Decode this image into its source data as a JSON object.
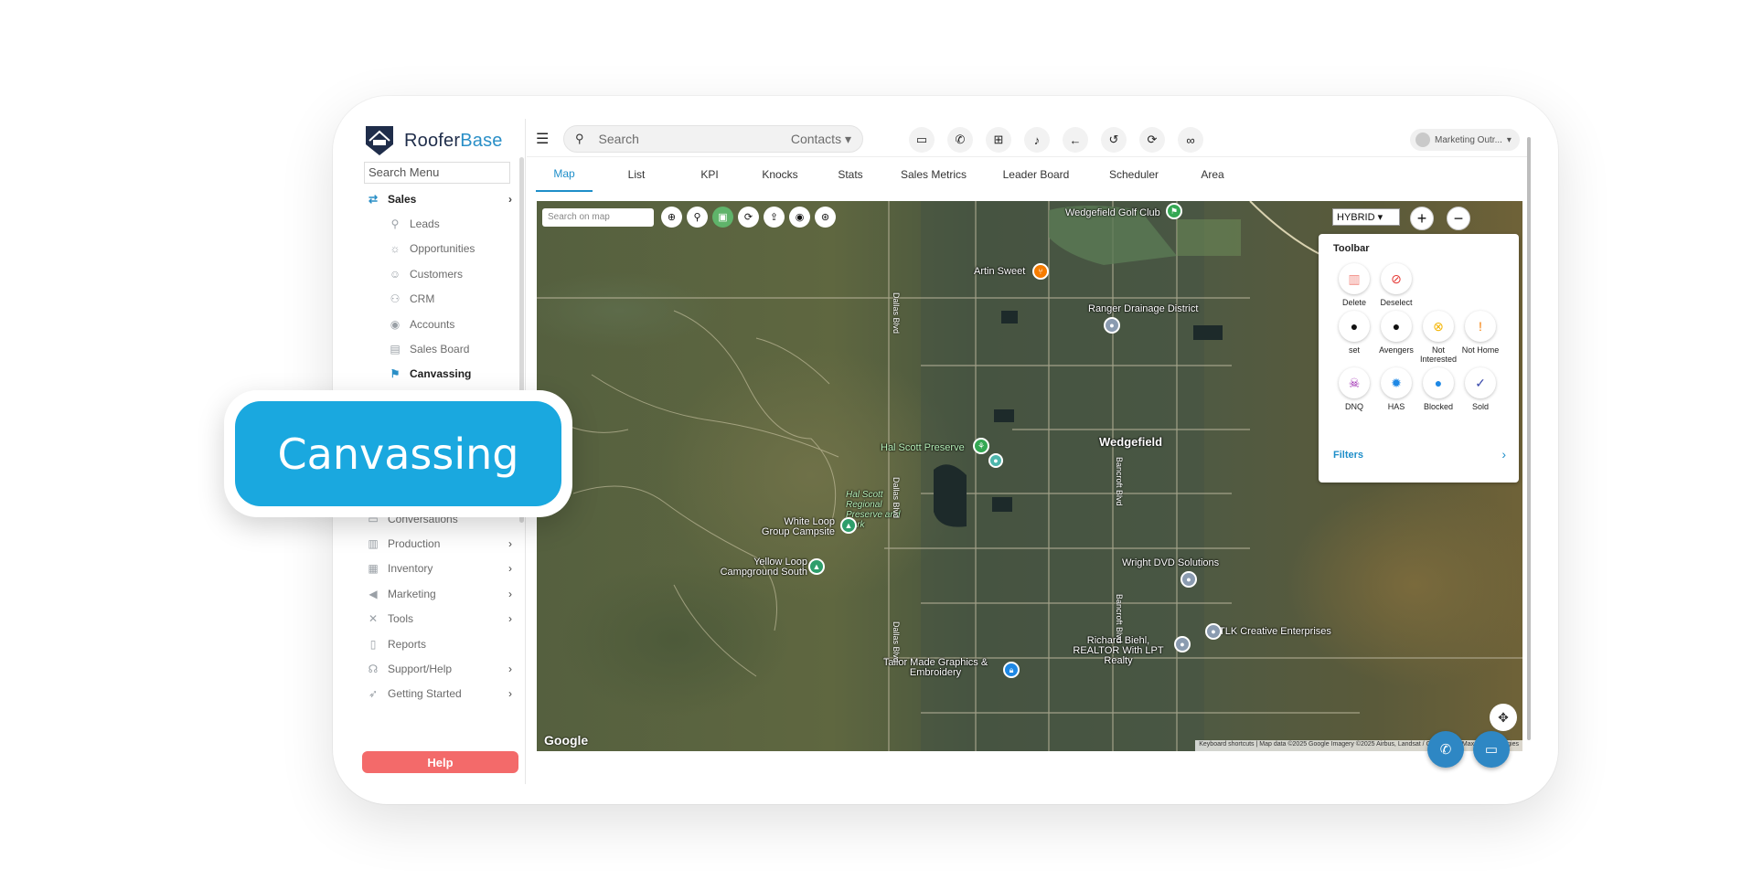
{
  "brand": {
    "name_part1": "Roofer",
    "name_part2": "Base"
  },
  "sidebar": {
    "search_placeholder": "Search Menu",
    "section_label": "Sales",
    "items": [
      {
        "label": "Leads",
        "icon": "leads-icon"
      },
      {
        "label": "Opportunities",
        "icon": "opportunities-icon"
      },
      {
        "label": "Customers",
        "icon": "customers-icon"
      },
      {
        "label": "CRM",
        "icon": "crm-icon"
      },
      {
        "label": "Accounts",
        "icon": "accounts-icon"
      },
      {
        "label": "Sales Board",
        "icon": "sales-board-icon"
      },
      {
        "label": "Canvassing",
        "icon": "canvassing-icon",
        "active": true
      }
    ],
    "lower_items": [
      {
        "label": "Conversations",
        "icon": "conversations-icon",
        "chevron": false
      },
      {
        "label": "Production",
        "icon": "production-icon",
        "chevron": true
      },
      {
        "label": "Inventory",
        "icon": "inventory-icon",
        "chevron": true
      },
      {
        "label": "Marketing",
        "icon": "marketing-icon",
        "chevron": true
      },
      {
        "label": "Tools",
        "icon": "tools-icon",
        "chevron": true
      },
      {
        "label": "Reports",
        "icon": "reports-icon",
        "chevron": false
      },
      {
        "label": "Support/Help",
        "icon": "support-icon",
        "chevron": true
      },
      {
        "label": "Getting Started",
        "icon": "rocket-icon",
        "chevron": true
      }
    ],
    "help_label": "Help"
  },
  "topbar": {
    "search_placeholder": "Search",
    "search_scope": "Contacts",
    "icons": [
      "message-icon",
      "phone-icon",
      "add-box-icon",
      "bell-icon",
      "back-arrow-icon",
      "history-icon",
      "refresh-icon",
      "glasses-icon"
    ],
    "user_label": "Marketing Outr..."
  },
  "tabs": [
    "Map",
    "List",
    "KPI",
    "Knocks",
    "Stats",
    "Sales Metrics",
    "Leader Board",
    "Scheduler",
    "Area"
  ],
  "active_tab": "Map",
  "map": {
    "search_placeholder": "Search on map",
    "map_type": "HYBRID",
    "toolbar": {
      "title": "Toolbar",
      "items": [
        {
          "label": "Delete",
          "color": "#f28b82"
        },
        {
          "label": "Deselect",
          "color": "#e53935"
        },
        {
          "label": "set",
          "color": "#111111"
        },
        {
          "label": "Avengers",
          "color": "#111111"
        },
        {
          "label": "Not Interested",
          "color": "#f4b400"
        },
        {
          "label": "Not Home",
          "color": "#f57c00"
        },
        {
          "label": "DNQ",
          "color": "#9c27b0"
        },
        {
          "label": "HAS",
          "color": "#1e88e5"
        },
        {
          "label": "Blocked",
          "color": "#1e88e5"
        },
        {
          "label": "Sold",
          "color": "#3949ab"
        }
      ],
      "filters_label": "Filters"
    },
    "places": {
      "golf": "Wedgefield Golf Club",
      "artin": "Artin Sweet",
      "ranger": "Ranger Drainage District",
      "wedgefield": "Wedgefield",
      "hal_scott": "Hal Scott Preserve",
      "hal_regional": "Hal Scott Regional Preserve and Park",
      "white_loop": "White Loop Group Campsite",
      "yellow_loop": "Yellow Loop Campground South",
      "wright": "Wright DVD Solutions",
      "tlk": "TLK Creative Enterprises",
      "richard": "Richard Biehl, REALTOR With LPT Realty",
      "tailor": "Tailor Made Graphics & Embroidery",
      "dallas_blvd": "Dallas Blvd",
      "bancroft_blvd": "Bancroft Blvd"
    },
    "google_logo": "Google",
    "attribution": "Keyboard shortcuts  |  Map data ©2025 Google Imagery ©2025 Airbus, Landsat / Copernicus, Maxar Technologies"
  },
  "callout": {
    "label": "Canvassing"
  },
  "colors": {
    "accent": "#1e8ec9",
    "help": "#f36a6a",
    "callout": "#1aa8df"
  }
}
